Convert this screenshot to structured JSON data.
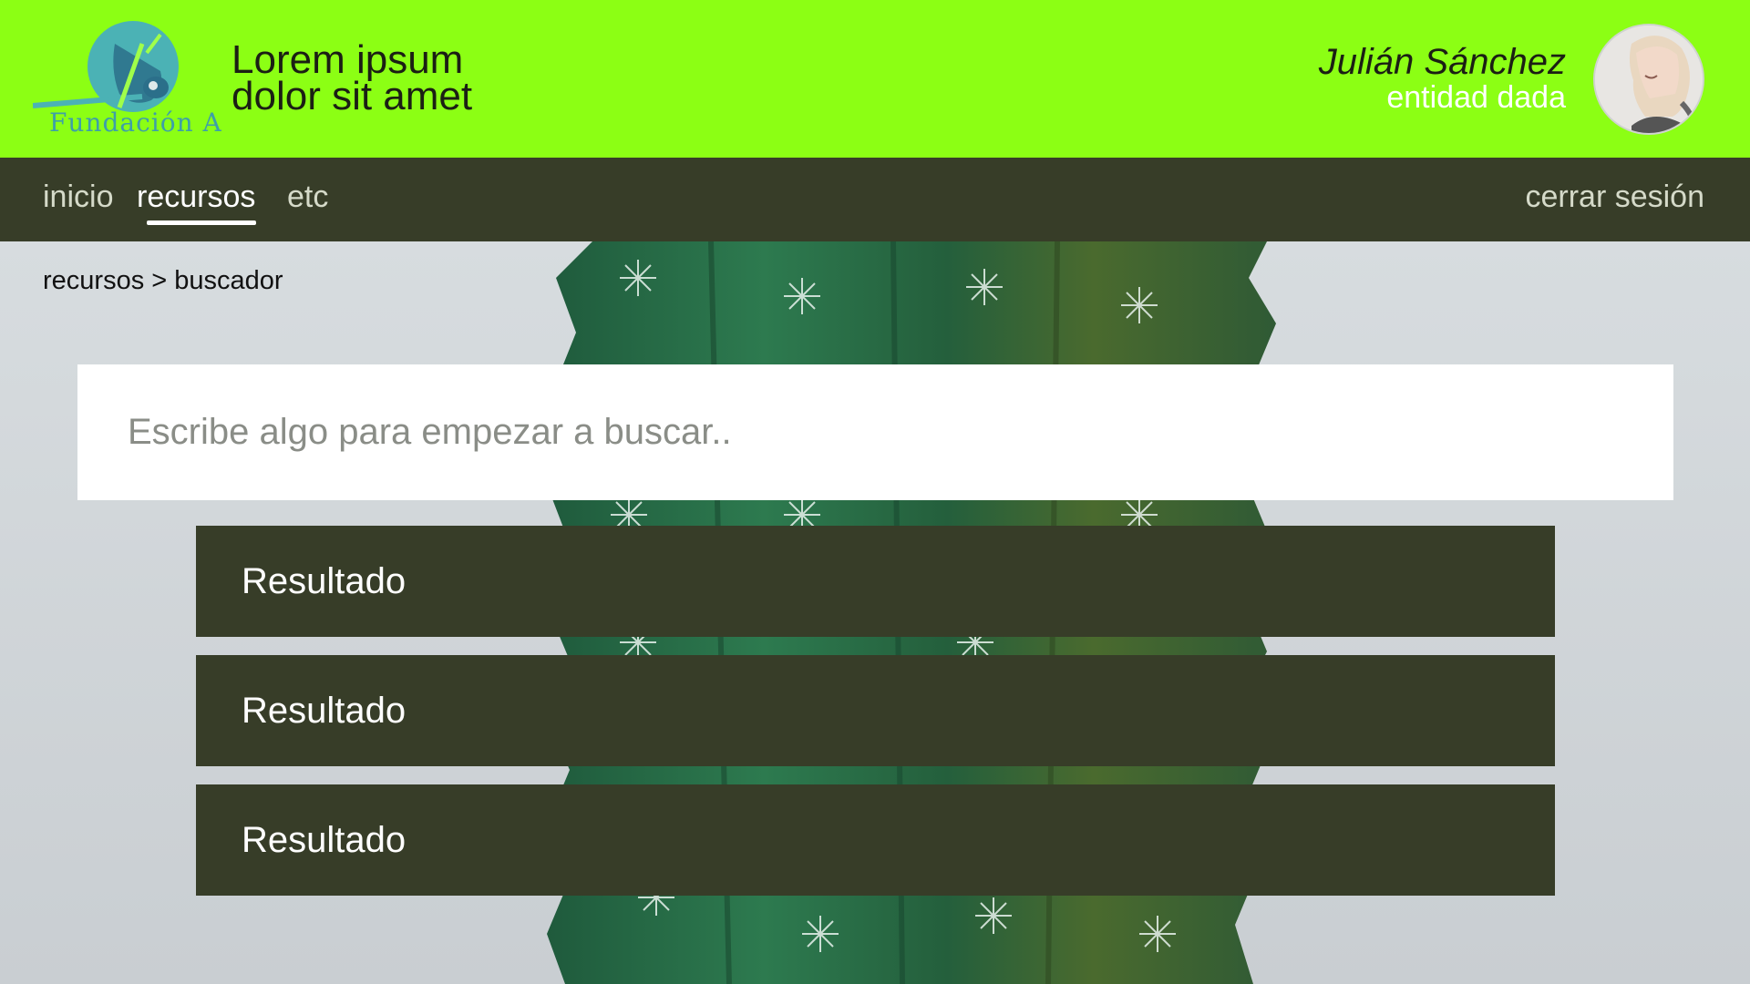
{
  "header": {
    "logo_text": "Fundación A",
    "title_line1": "Lorem ipsum",
    "title_line2": "dolor sit amet",
    "user_name": "Julián Sánchez",
    "user_entity": "entidad dada",
    "background_color": "#8cff14"
  },
  "nav": {
    "items": [
      {
        "label": "inicio",
        "active": false
      },
      {
        "label": "recursos",
        "active": true
      },
      {
        "label": "etc",
        "active": false
      }
    ],
    "logout_label": "cerrar sesión",
    "background_color": "#373d28"
  },
  "breadcrumb": "recursos > buscador",
  "search": {
    "placeholder": "Escribe algo para empezar a buscar..",
    "value": ""
  },
  "results": [
    {
      "label": "Resultado"
    },
    {
      "label": "Resultado"
    },
    {
      "label": "Resultado"
    }
  ]
}
